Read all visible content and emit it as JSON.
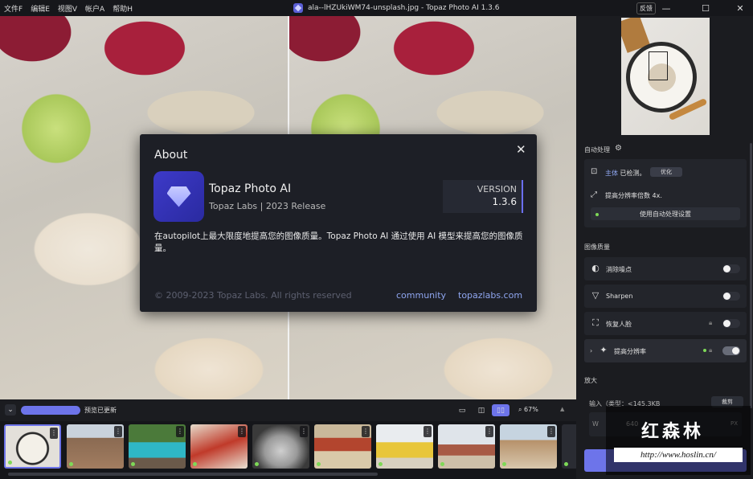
{
  "menu": [
    "文件F",
    "编辑E",
    "视图V",
    "帐户A",
    "帮助H"
  ],
  "window": {
    "title": "ala--lHZUkiWM74-unsplash.jpg - Topaz Photo AI 1.3.6",
    "feedback": "反馈",
    "min_icon": "minimize-icon",
    "max_icon": "maximize-icon",
    "close_icon": "close-icon"
  },
  "about": {
    "title": "About",
    "app_name": "Topaz Photo AI",
    "subtitle": "Topaz Labs | 2023 Release",
    "version_label": "VERSION",
    "version": "1.3.6",
    "description": "在autopilot上最大限度地提高您的图像质量。Topaz Photo AI 通过使用 AI 模型来提高您的图像质量。",
    "copyright": "© 2009-2023 Topaz Labs. All rights reserved",
    "link_community": "community",
    "link_site": "topazlabs.com",
    "close_glyph": "✕"
  },
  "bottombar": {
    "status": "预览已更新",
    "zoom": "67%"
  },
  "sidebar": {
    "auto_header": "自动处理",
    "subject_label": "主体",
    "subject_detected": "已检测。",
    "optimize": "优化",
    "upscale_factor": "提高分辨率倍数 4x.",
    "auto_settings": "使用自动处理设置",
    "quality_header": "图像质量",
    "items": [
      {
        "label": "消除噪点",
        "icon": "denoise-icon"
      },
      {
        "label": "Sharpen",
        "icon": "sharpen-icon"
      },
      {
        "label": "恢复人脸",
        "icon": "face-recovery-icon"
      },
      {
        "label": "提高分辨率",
        "icon": "upscale-icon"
      }
    ],
    "enlarge_header": "放大",
    "input_label": "输入（类型：<145.3KB",
    "input_btn": "裁剪",
    "dim_w": "W",
    "dim_value": "640",
    "dim_unit": "PX"
  },
  "watermark": {
    "cn": "红森林",
    "url": "http://www.hoslin.cn/"
  },
  "colors": {
    "accent": "#6d74ea",
    "link": "#8fa6f0",
    "ok": "#7ed957"
  }
}
